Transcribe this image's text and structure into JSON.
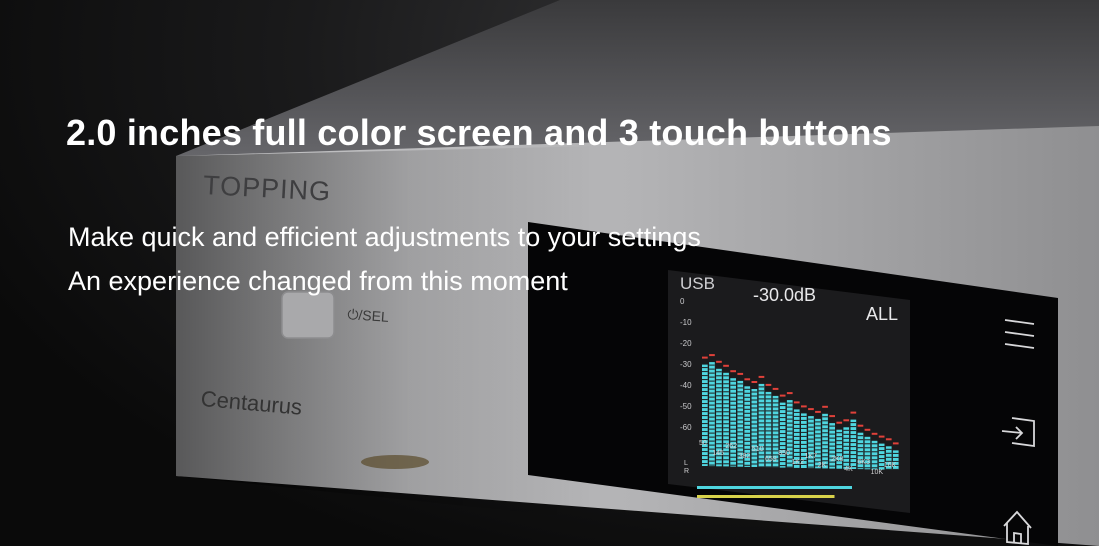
{
  "headline": "2.0 inches full color screen and 3 touch buttons",
  "subtitle_lines": [
    "Make quick and efficient adjustments to your settings",
    "An experience changed from this moment"
  ],
  "device": {
    "brand": "TOPPING",
    "model": "Centaurus",
    "power_label": "⏻/SEL"
  },
  "screen": {
    "source": "USB",
    "volume": "-30.0dB",
    "mode": "ALL",
    "db_scale": [
      "0",
      "-10",
      "-20",
      "-30",
      "-40",
      "-50",
      "-60"
    ],
    "freq_labels": [
      "50",
      "145",
      "262",
      "382",
      "510",
      "659",
      "850",
      "1K2",
      "1K7",
      "2K",
      "2K8",
      "4K",
      "6K3",
      "10K",
      "16K"
    ],
    "channels": [
      "L",
      "R"
    ],
    "spectrum_levels": [
      0.78,
      0.8,
      0.75,
      0.72,
      0.68,
      0.66,
      0.62,
      0.6,
      0.64,
      0.58,
      0.55,
      0.5,
      0.52,
      0.45,
      0.42,
      0.4,
      0.38,
      0.42,
      0.35,
      0.3,
      0.32,
      0.38,
      0.28,
      0.25,
      0.22,
      0.2,
      0.18,
      0.15
    ],
    "lr_levels": [
      0.62,
      0.55
    ],
    "accent_bar": "#4fd6e0",
    "accent_peak": "#e0413a"
  },
  "touch_buttons": [
    "menu-icon",
    "input-icon",
    "home-icon"
  ]
}
